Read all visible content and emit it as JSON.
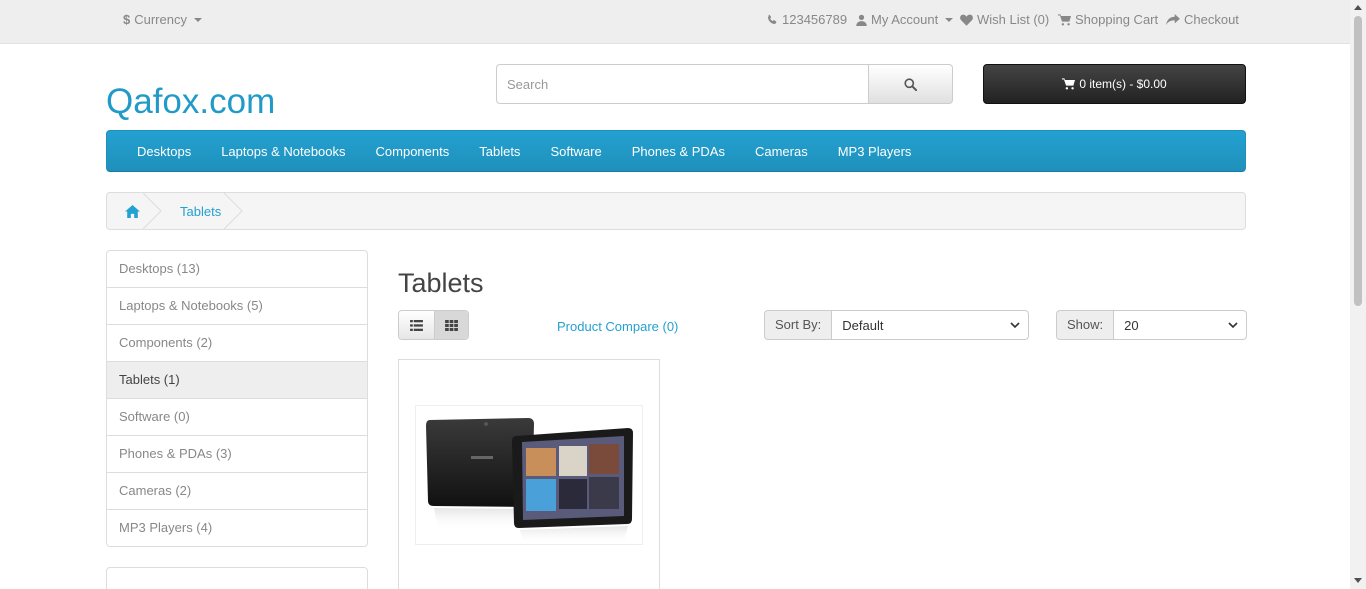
{
  "topbar": {
    "currency_symbol": "$",
    "currency_label": "Currency",
    "phone": "123456789",
    "my_account": "My Account",
    "wish_list": "Wish List (0)",
    "shopping_cart": "Shopping Cart",
    "checkout": "Checkout"
  },
  "header": {
    "logo": "Qafox.com",
    "search_placeholder": "Search",
    "cart_button": "0 item(s) - $0.00"
  },
  "menu": {
    "items": [
      "Desktops",
      "Laptops & Notebooks",
      "Components",
      "Tablets",
      "Software",
      "Phones & PDAs",
      "Cameras",
      "MP3 Players"
    ]
  },
  "breadcrumb": {
    "current": "Tablets"
  },
  "sidebar": {
    "items": [
      {
        "label": "Desktops (13)"
      },
      {
        "label": "Laptops & Notebooks (5)"
      },
      {
        "label": "Components (2)"
      },
      {
        "label": "Tablets (1)"
      },
      {
        "label": "Software (0)"
      },
      {
        "label": "Phones & PDAs (3)"
      },
      {
        "label": "Cameras (2)"
      },
      {
        "label": "MP3 Players (4)"
      }
    ],
    "active_index": 3
  },
  "content": {
    "title": "Tablets",
    "compare_link": "Product Compare (0)",
    "sort_label": "Sort By:",
    "sort_value": "Default",
    "show_label": "Show:",
    "show_value": "20"
  },
  "colors": {
    "accent": "#23a1d1",
    "cart_bg": "#222222"
  }
}
